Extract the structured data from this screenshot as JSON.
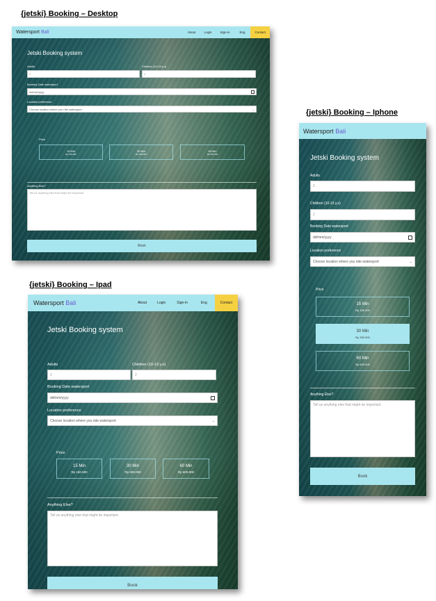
{
  "captions": {
    "desktop": "{jetski} Booking – Desktop",
    "iphone": "{jetski} Booking – Iphone",
    "ipad": "{jetski} Booking – Ipad"
  },
  "nav": {
    "brand": "Watersport",
    "brand_accent": "Bali",
    "links": [
      "About",
      "Login",
      "Sign-in",
      "Eng"
    ],
    "contact": "Contact"
  },
  "form": {
    "title": "Jetski Booking system",
    "adults_label": "Adults",
    "adults_value": "2",
    "children_label": "Children (10-13 y.o)",
    "children_value": "2",
    "date_label": "Booking Date watersport",
    "date_placeholder": "dd/mm/yyyy",
    "location_label": "Location preference",
    "location_value": "Choose location where you ride watersport",
    "price_label": "Price",
    "prices": [
      {
        "duration": "15 Min",
        "amount": "Rp 150.000"
      },
      {
        "duration": "30 Min",
        "amount": "Rp 300.000"
      },
      {
        "duration": "60 Min",
        "amount": "Rp 600.000"
      }
    ],
    "anything_label": "Anything Else?",
    "anything_placeholder": "Tell us anything else that might be important.",
    "book_label": "Book"
  },
  "colors": {
    "nav_bg": "#a8e6ef",
    "brand_accent": "#6a5acd",
    "contact_bg": "#f5d142",
    "book_bg": "#a8e6ef"
  }
}
